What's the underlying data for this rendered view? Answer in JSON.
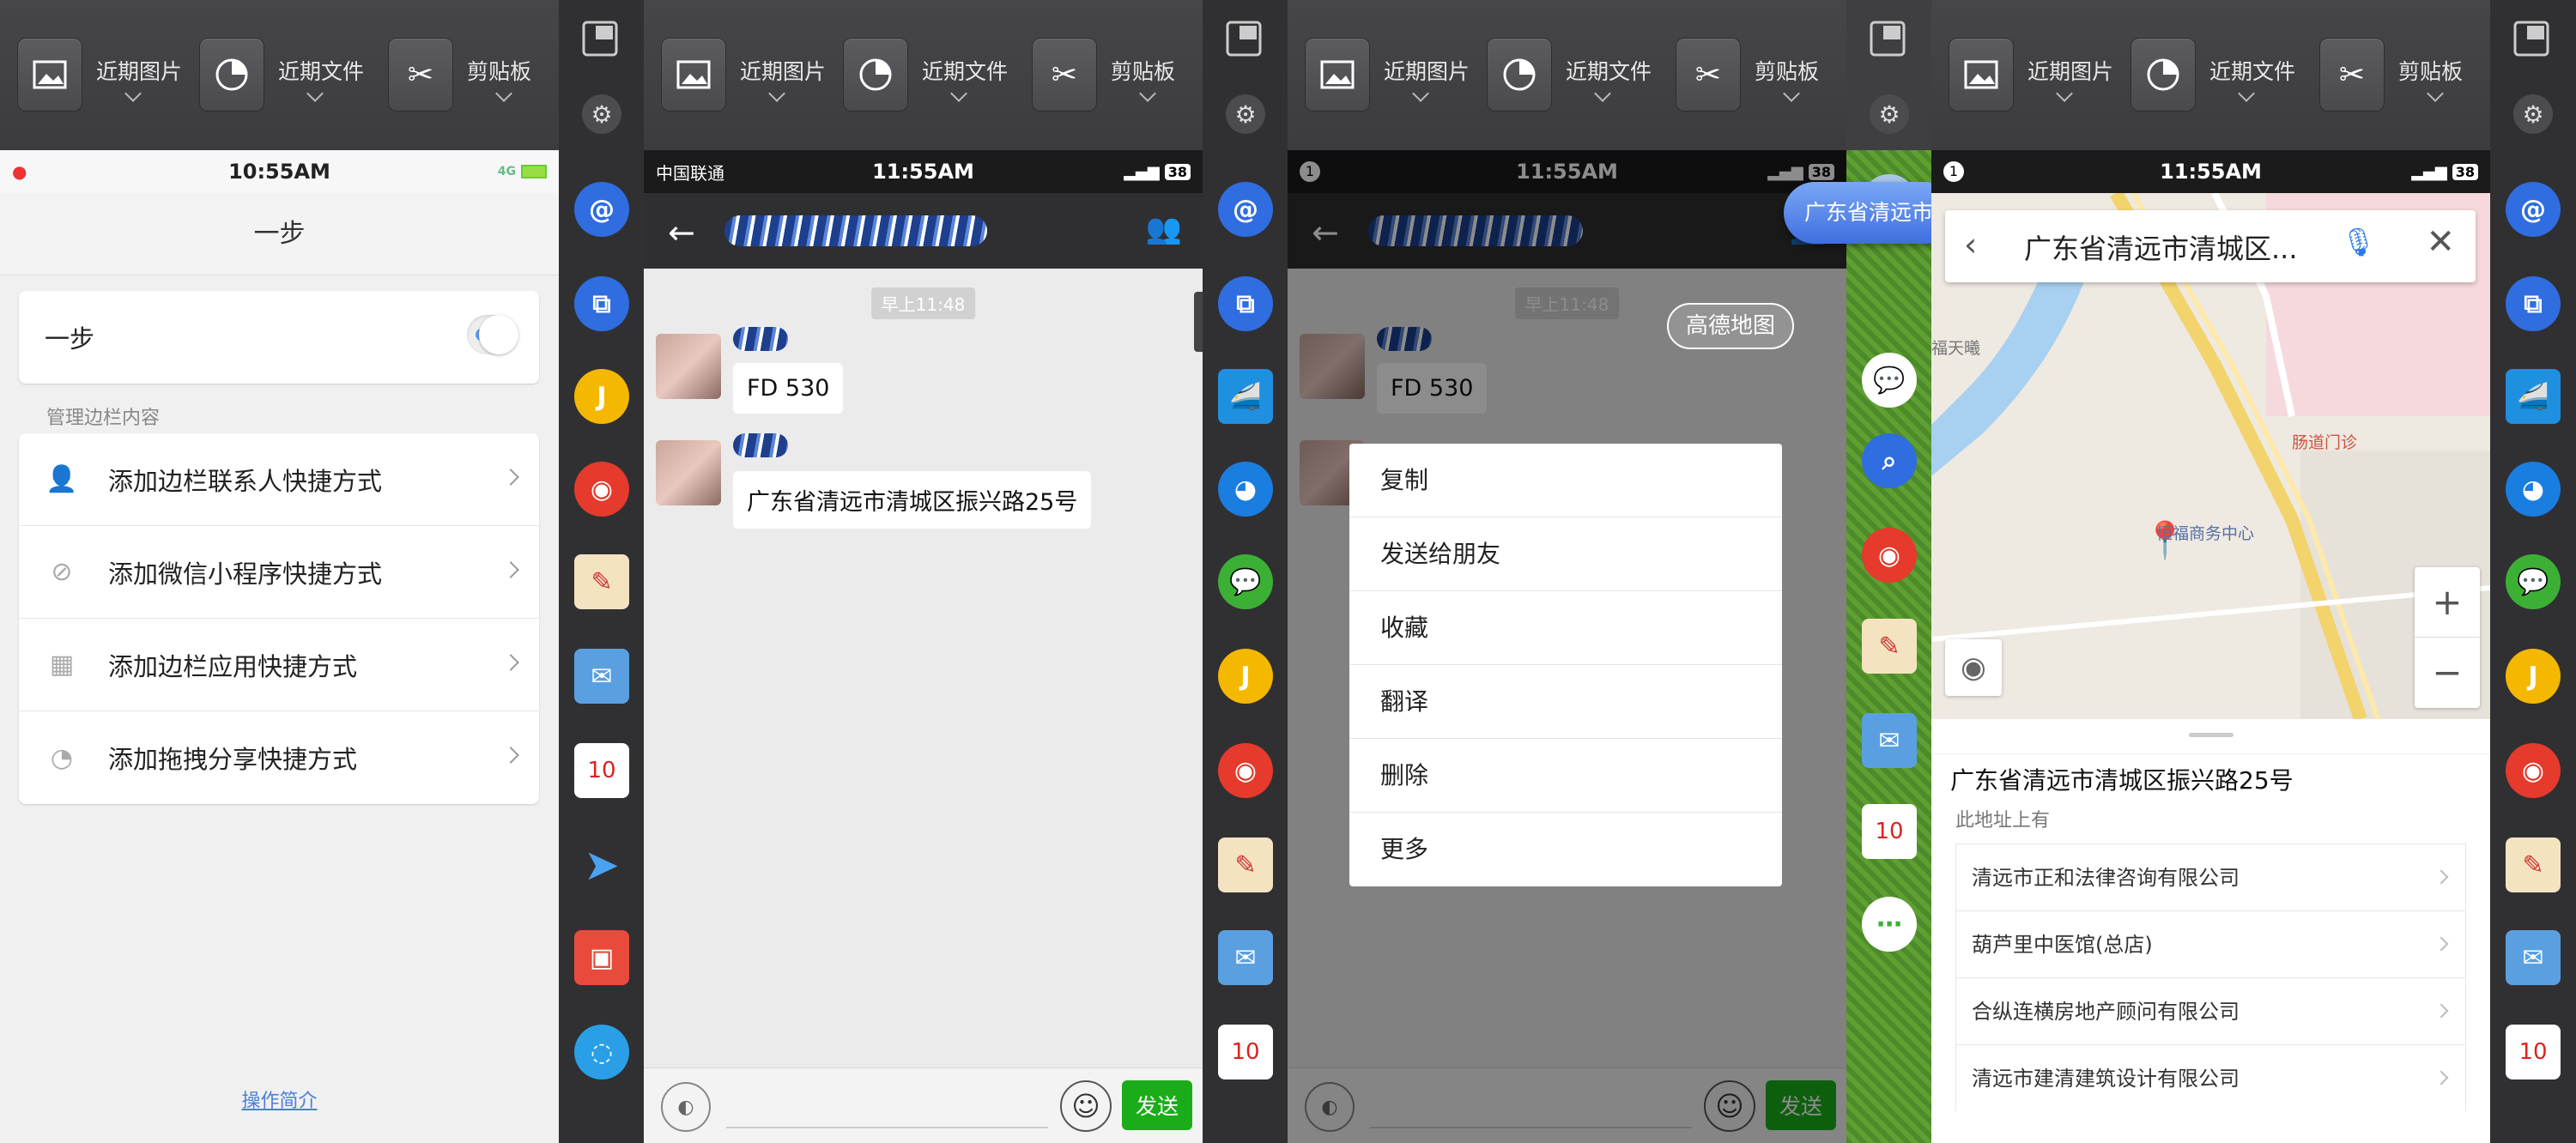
{
  "toolbar": {
    "recent_images": "近期图片",
    "recent_files": "近期文件",
    "clipboard": "剪贴板"
  },
  "panel1": {
    "status_time": "10:55AM",
    "status_net": "4G",
    "title": "一步",
    "toggle_label": "一步",
    "section_label": "管理边栏内容",
    "items": [
      {
        "label": "添加边栏联系人快捷方式"
      },
      {
        "label": "添加微信小程序快捷方式"
      },
      {
        "label": "添加边栏应用快捷方式"
      },
      {
        "label": "添加拖拽分享快捷方式"
      }
    ],
    "footer_link": "操作简介"
  },
  "panel2": {
    "carrier": "中国联通",
    "status_time": "11:55AM",
    "battery": "38",
    "timestamp": "早上11:48",
    "msg1": "FD 530",
    "msg2": "广东省清远市清城区振兴路25号",
    "send": "发送"
  },
  "panel3": {
    "status_badge": "1",
    "status_time": "11:55AM",
    "battery": "38",
    "timestamp": "早上11:48",
    "msg1": "FD 530",
    "map_pill": "高德地图",
    "drag_text": "广东省清远市",
    "menu": [
      "复制",
      "发送给朋友",
      "收藏",
      "翻译",
      "删除",
      "更多"
    ],
    "send": "发送"
  },
  "panel4": {
    "status_badge": "1",
    "status_time": "11:55AM",
    "battery": "38",
    "search_text": "广东省清远市清城区...",
    "map_label1": "肠道门诊",
    "map_label2": "恒福商务中心",
    "map_label3": "福天曦",
    "zoom_in": "+",
    "zoom_out": "−",
    "address": "广东省清远市清城区振兴路25号",
    "address_sub": "此地址上有",
    "pois": [
      "清远市正和法律咨询有限公司",
      "葫芦里中医馆(总店)",
      "合纵连横房地产顾问有限公司",
      "清远市建清建筑设计有限公司"
    ]
  },
  "sidebar": {
    "calendar_day": "10"
  }
}
